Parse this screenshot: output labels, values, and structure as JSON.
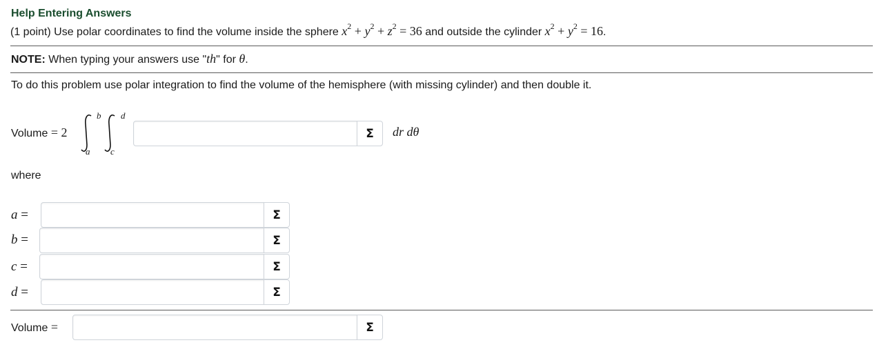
{
  "header": {
    "help_link": "Help Entering Answers"
  },
  "problem": {
    "intro": "(1 point) Use polar coordinates to find the volume inside the sphere",
    "sphere_eq": "x² + y² + z² = 36",
    "middle": "and outside the cylinder",
    "cylinder_eq": "x² + y² = 16"
  },
  "note": {
    "bold": "NOTE:",
    "text_before": "When typing your answers use \"",
    "th": "th",
    "text_mid": "\" for",
    "theta": "θ"
  },
  "instruction": "To do this problem use polar integration to find the volume of the hemisphere (with missing cylinder) and then double it.",
  "integral": {
    "volume_label": "Volume",
    "equals": "=",
    "coefficient": "2",
    "outer_lower": "a",
    "outer_upper": "b",
    "inner_lower": "c",
    "inner_upper": "d",
    "differentials": "dr dθ"
  },
  "where_label": "where",
  "variables": [
    {
      "name": "a",
      "value": ""
    },
    {
      "name": "b",
      "value": ""
    },
    {
      "name": "c",
      "value": ""
    },
    {
      "name": "d",
      "value": ""
    }
  ],
  "integrand_answer": {
    "value": ""
  },
  "final_volume": {
    "label": "Volume",
    "equals": "=",
    "value": ""
  },
  "icons": {
    "equation_editor": "sigma-icon"
  }
}
